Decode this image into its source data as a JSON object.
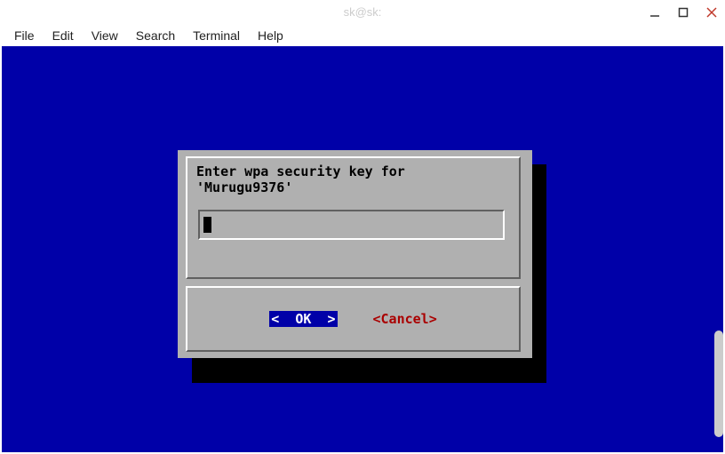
{
  "titlebar": {
    "title": "sk@sk:"
  },
  "menubar": {
    "items": [
      "File",
      "Edit",
      "View",
      "Search",
      "Terminal",
      "Help"
    ]
  },
  "dialog": {
    "prompt_line1": "Enter wpa security key for",
    "prompt_line2": "'Murugu9376'",
    "input_value": "",
    "ok_label": "<  OK  >",
    "cancel_label": "<Cancel>"
  }
}
